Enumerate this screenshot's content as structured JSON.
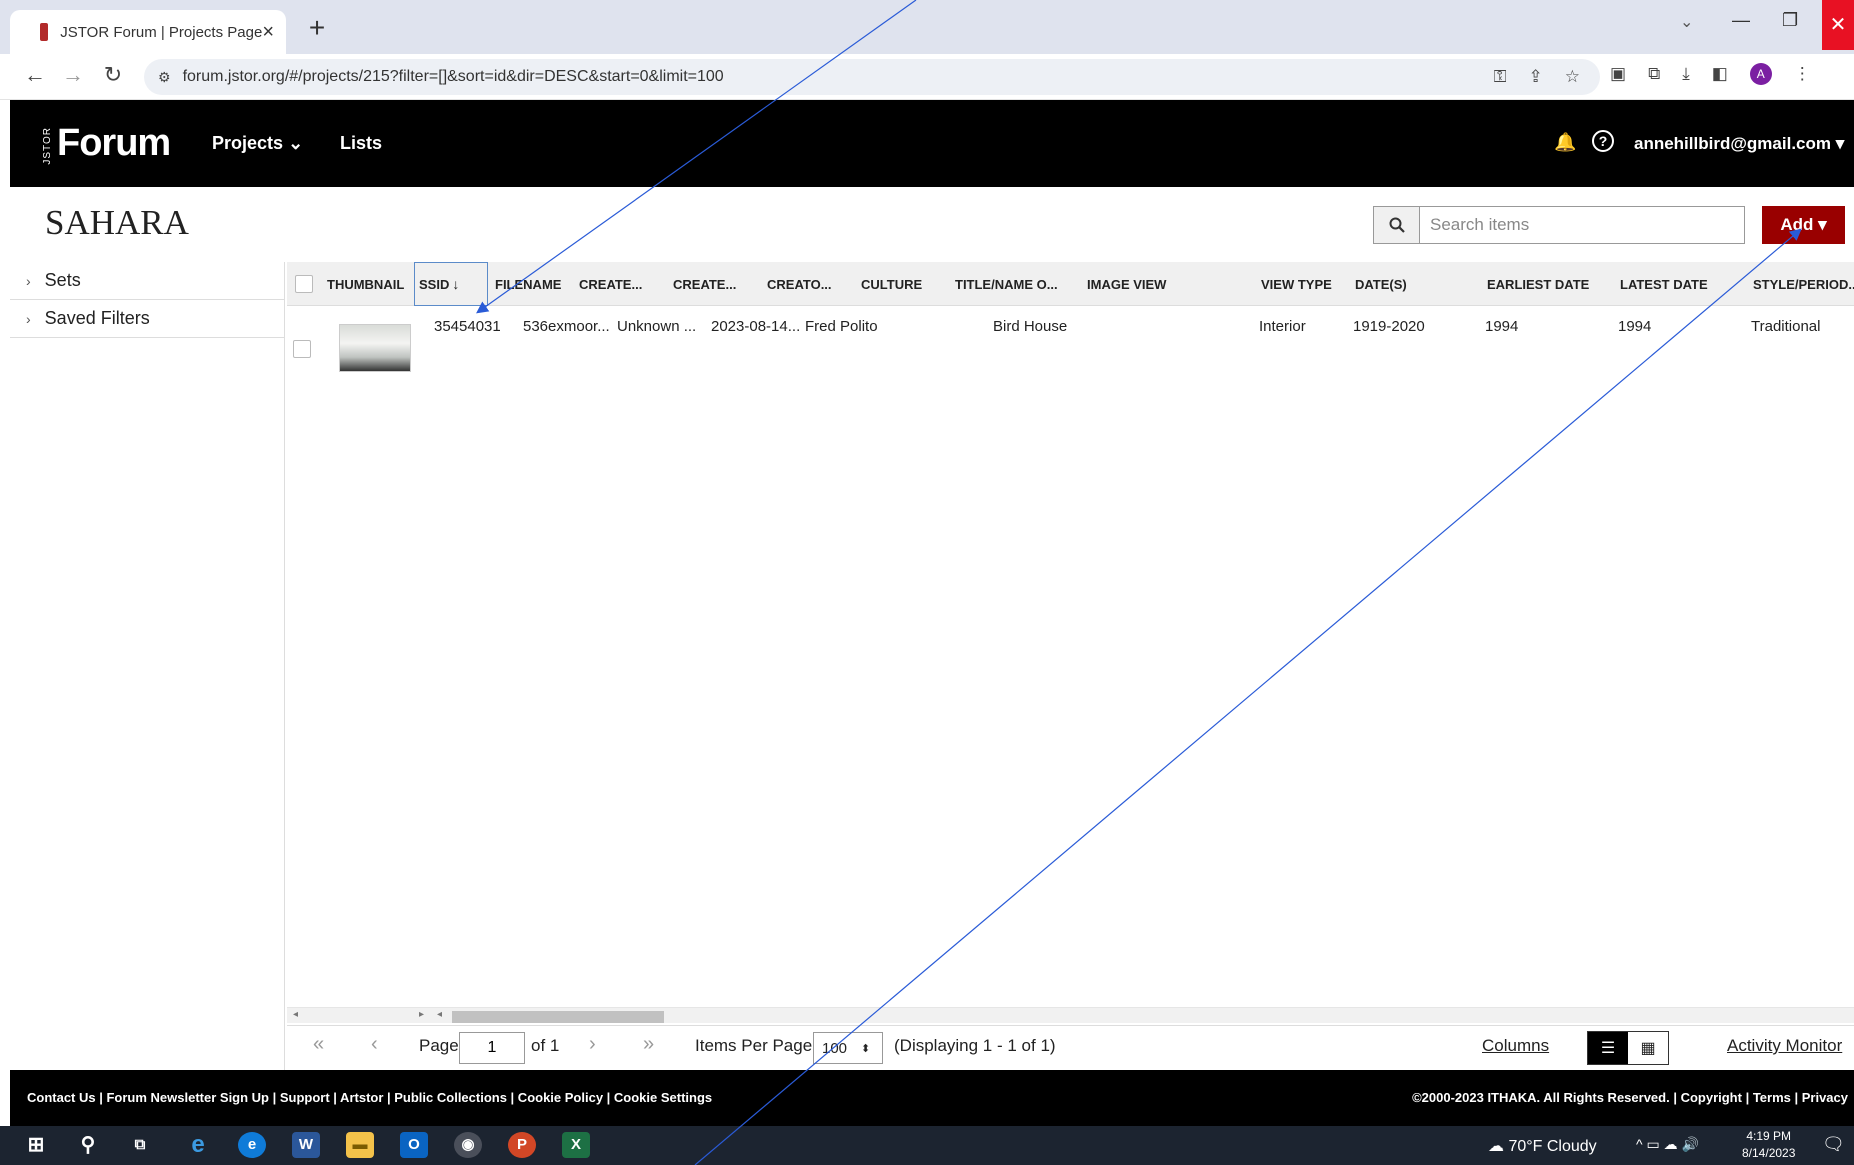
{
  "browser": {
    "tab_title": "JSTOR Forum | Projects Page",
    "url": "forum.jstor.org/#/projects/215?filter=[]&sort=id&dir=DESC&start=0&limit=100",
    "profile_initial": "A"
  },
  "app": {
    "logo_small": "JSTOR",
    "logo": "Forum",
    "nav": {
      "projects": "Projects",
      "lists": "Lists"
    },
    "user": "annehillbird@gmail.com"
  },
  "project": {
    "title": "SAHARA",
    "search_placeholder": "Search items",
    "add_label": "Add"
  },
  "sidebar": {
    "items": [
      {
        "label": "Sets"
      },
      {
        "label": "Saved Filters"
      }
    ]
  },
  "grid": {
    "columns": [
      "THUMBNAIL",
      "SSID",
      "FILENAME",
      "CREATE...",
      "CREATE...",
      "CREATO...",
      "CULTURE",
      "TITLE/NAME O...",
      "IMAGE VIEW",
      "VIEW TYPE",
      "DATE(S)",
      "EARLIEST DATE",
      "LATEST DATE",
      "STYLE/PERIOD..."
    ],
    "sorted_column": "SSID",
    "rows": [
      {
        "ssid": "35454031",
        "filename": "536exmoor...",
        "created_by": "Unknown ...",
        "created_on": "2023-08-14...",
        "creator": "Fred Polito",
        "culture": "",
        "title": "Bird House",
        "image_view": "",
        "view_type": "Interior",
        "dates": "1919-2020",
        "earliest": "1994",
        "latest": "1994",
        "style": "Traditional"
      }
    ]
  },
  "pager": {
    "page_label": "Page",
    "page_value": "1",
    "of_label": "of 1",
    "per_page_label": "Items Per Page",
    "per_page_value": "100",
    "displaying": "(Displaying 1 - 1 of 1)",
    "columns_link": "Columns",
    "activity_link": "Activity Monitor"
  },
  "footer": {
    "left": "Contact Us | Forum Newsletter Sign Up | Support | Artstor | Public Collections | Cookie Policy |  Cookie Settings",
    "right": "©2000-2023 ITHAKA. All Rights Reserved. | Copyright | Terms | Privacy"
  },
  "taskbar": {
    "weather": "70°F  Cloudy",
    "time": "4:19 PM",
    "date": "8/14/2023"
  },
  "colors": {
    "brand_red": "#990000",
    "header_bg": "#000000",
    "annotation_line": "#2a5bd7"
  }
}
